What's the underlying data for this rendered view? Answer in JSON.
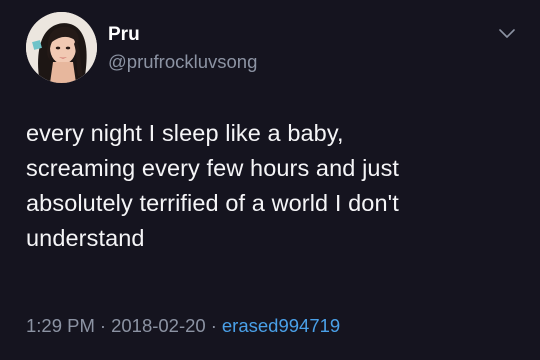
{
  "tweet": {
    "author_name": "Pru",
    "author_handle": "@prufrockluvsong",
    "text": "every night I sleep like a baby,\nscreaming every few hours and just\nabsolutely terrified of a world I don't\nunderstand",
    "time": "1:29 PM",
    "date": "2018-02-20",
    "separator": "·",
    "source": "erased994719"
  },
  "icons": {
    "menu": "chevron-down-icon",
    "avatar": "profile-avatar"
  },
  "colors": {
    "background": "#15141f",
    "name": "#ffffff",
    "secondary": "#8c93a3",
    "link": "#4aa0e8",
    "text": "#f5f5f7"
  }
}
